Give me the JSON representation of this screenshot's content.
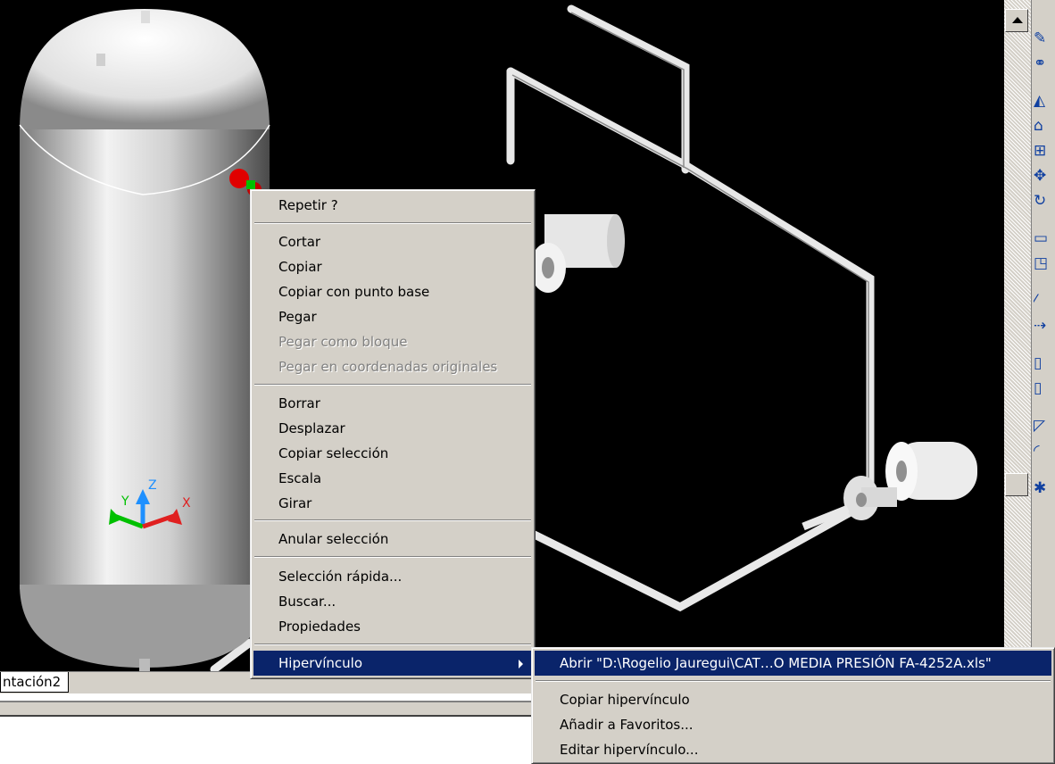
{
  "context_menu": {
    "items": [
      {
        "label": "Repetir ?",
        "enabled": true
      },
      {
        "label": "Cortar",
        "enabled": true
      },
      {
        "label": "Copiar",
        "enabled": true
      },
      {
        "label": "Copiar con punto base",
        "enabled": true
      },
      {
        "label": "Pegar",
        "enabled": true
      },
      {
        "label": "Pegar como bloque",
        "enabled": false
      },
      {
        "label": "Pegar en coordenadas originales",
        "enabled": false
      },
      {
        "label": "Borrar",
        "enabled": true
      },
      {
        "label": "Desplazar",
        "enabled": true
      },
      {
        "label": "Copiar selección",
        "enabled": true
      },
      {
        "label": "Escala",
        "enabled": true
      },
      {
        "label": "Girar",
        "enabled": true
      },
      {
        "label": "Anular selección",
        "enabled": true
      },
      {
        "label": "Selección rápida...",
        "enabled": true
      },
      {
        "label": "Buscar...",
        "enabled": true
      },
      {
        "label": "Propiedades",
        "enabled": true
      },
      {
        "label": "Hipervínculo",
        "enabled": true,
        "highlighted": true,
        "has_submenu": true
      }
    ]
  },
  "submenu": {
    "items": [
      {
        "label": "Abrir \"D:\\Rogelio Jauregui\\CAT…O MEDIA PRESIÓN FA-4252A.xls\"",
        "highlighted": true
      },
      {
        "label": "Copiar hipervínculo"
      },
      {
        "label": "Añadir a Favoritos..."
      },
      {
        "label": "Editar hipervínculo..."
      }
    ]
  },
  "layout_tab": {
    "label": "ntación2"
  },
  "ucs_icon": {
    "x": "X",
    "y": "Y",
    "z": "Z"
  },
  "toolbar": {
    "tools": [
      "erase-icon",
      "copy-icon",
      "mirror-icon",
      "offset-icon",
      "array-icon",
      "move-icon",
      "rotate-icon",
      "scale-icon",
      "stretch-icon",
      "trim-icon",
      "extend-icon",
      "break-icon",
      "join-icon",
      "chamfer-icon",
      "fillet-icon",
      "explode-icon"
    ]
  },
  "colors": {
    "menu_bg": "#d4d0c8",
    "highlight": "#0a246a",
    "viewport_bg": "#000000",
    "grip_red": "#e00000",
    "grip_green": "#00c000"
  }
}
